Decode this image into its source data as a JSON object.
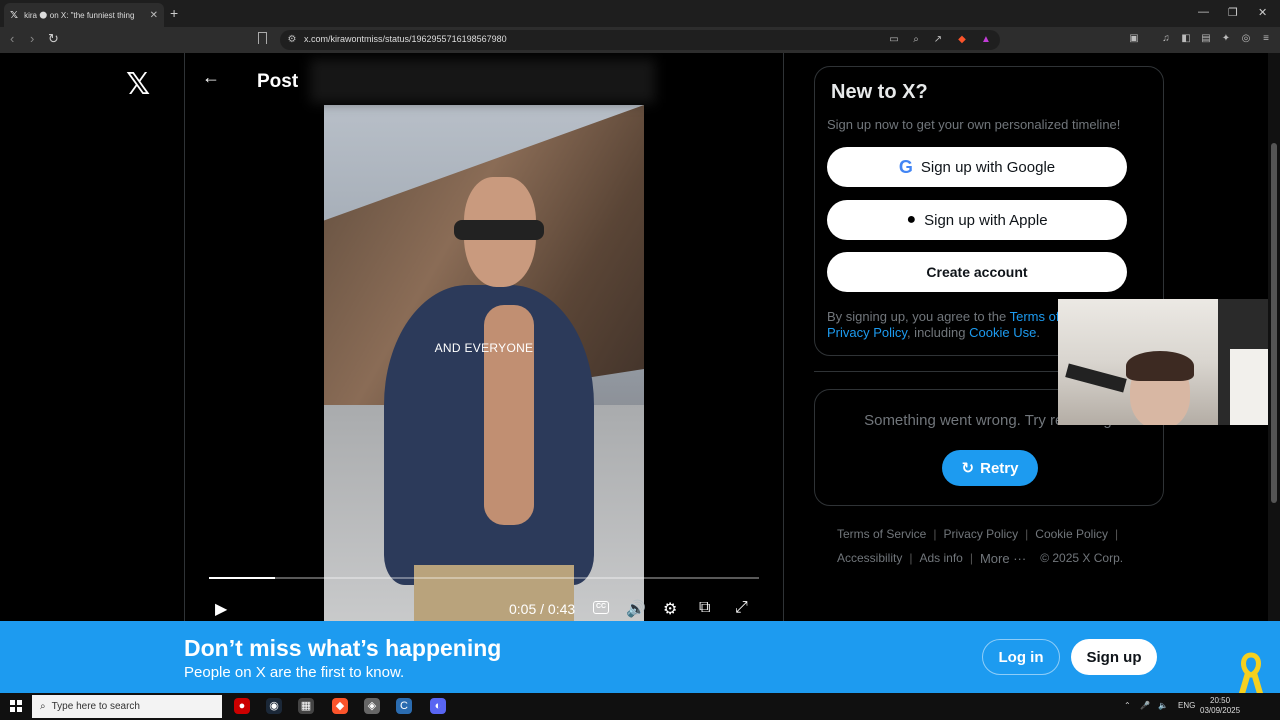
{
  "browser": {
    "tab_title": "kira 🌑 on X: \"the funniest thing",
    "tab_logo": "𝕏",
    "new_tab": "+",
    "url": "x.com/kirawontmiss/status/1962955716198567980",
    "window_controls": [
      "—",
      "❐",
      "✕"
    ]
  },
  "page": {
    "brand": "𝕏",
    "post_title": "Post",
    "back_arrow": "←"
  },
  "video": {
    "caption": "AND EVERYONE",
    "time": "0:05 / 0:43",
    "progress": 0.12,
    "cc_label": "CC"
  },
  "signup": {
    "title": "New to X?",
    "subtitle": "Sign up now to get your own personalized timeline!",
    "google_label": "Sign up with Google",
    "apple_label": "Sign up with Apple",
    "create_label": "Create account",
    "terms_prefix": "By signing up, you agree to the ",
    "terms_link": "Terms of",
    "privacy_link": "Privacy Policy",
    "terms_mid": ", including ",
    "cookie_link": "Cookie Use",
    "terms_end": "."
  },
  "error": {
    "message": "Something went wrong. Try reloading.",
    "retry_label": "Retry"
  },
  "footer": {
    "row1": [
      "Terms of Service",
      "Privacy Policy",
      "Cookie Policy"
    ],
    "row2": [
      "Accessibility",
      "Ads info",
      "More ···",
      "© 2025 X Corp."
    ]
  },
  "banner": {
    "title": "Don’t miss what’s happening",
    "subtitle": "People on X are the first to know.",
    "login_label": "Log in",
    "signup_label": "Sign up"
  },
  "taskbar": {
    "search_placeholder": "Type here to search",
    "lang": "ENG",
    "time": "20:50",
    "date": "03/09/2025"
  },
  "colors": {
    "accent": "#1d9bf0",
    "background": "#000000",
    "border": "#2f3336"
  }
}
